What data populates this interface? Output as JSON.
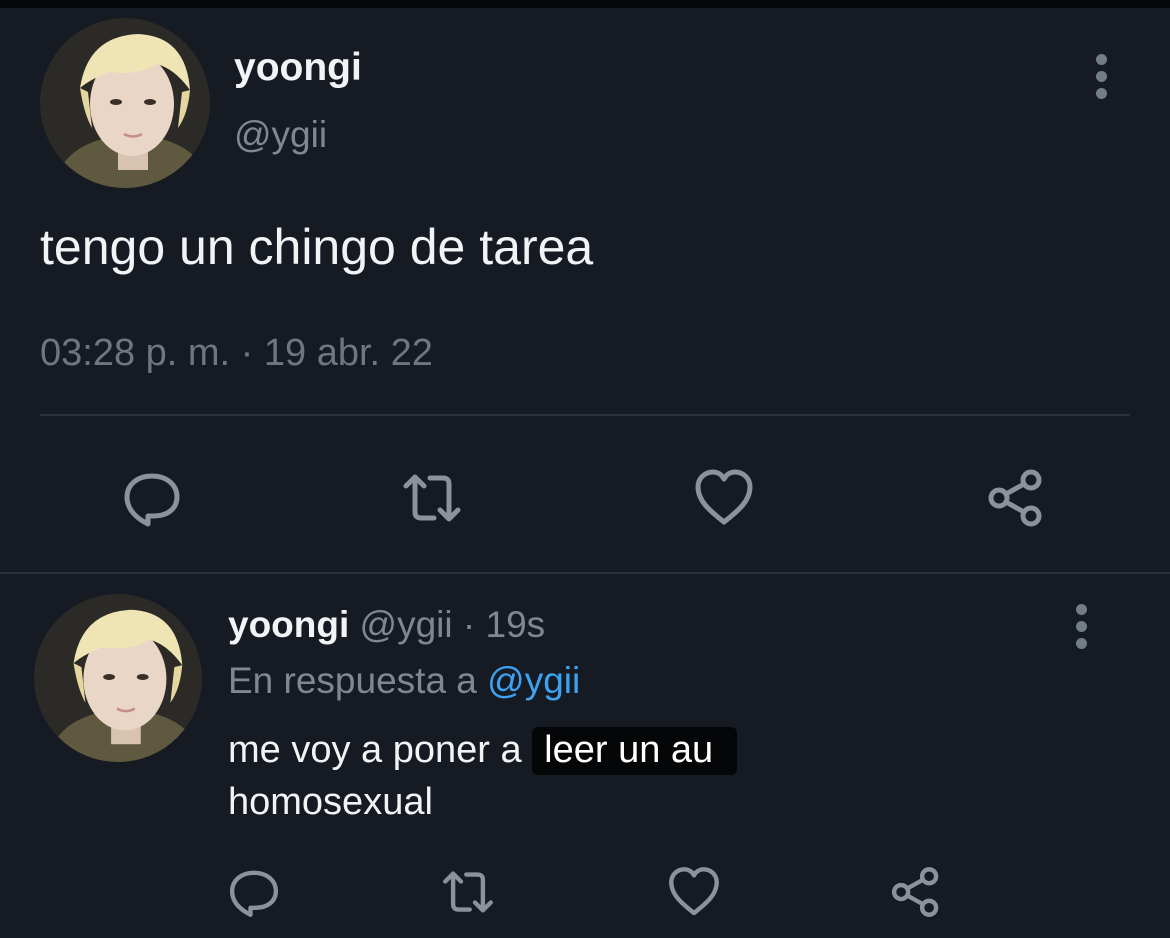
{
  "main_tweet": {
    "display_name": "yoongi",
    "handle": "@ygii",
    "text": "tengo un chingo de tarea",
    "timestamp": "03:28 p. m. · 19 abr. 22",
    "icons": {
      "reply": "reply-icon",
      "retweet": "retweet-icon",
      "like": "heart-icon",
      "share": "share-icon",
      "more": "more-vertical-icon"
    }
  },
  "reply_tweet": {
    "display_name": "yoongi",
    "meta": " @ygii · 19s",
    "reply_prefix": "En respuesta a ",
    "reply_mention": "@ygii",
    "text_before": "me voy a poner a ",
    "text_highlight": "leer un au",
    "text_after": "homosexual"
  },
  "colors": {
    "background": "#151a23",
    "text_primary": "#f1f3f5",
    "text_secondary": "#7f8891",
    "link": "#3da2f1",
    "divider": "#2a313a"
  }
}
